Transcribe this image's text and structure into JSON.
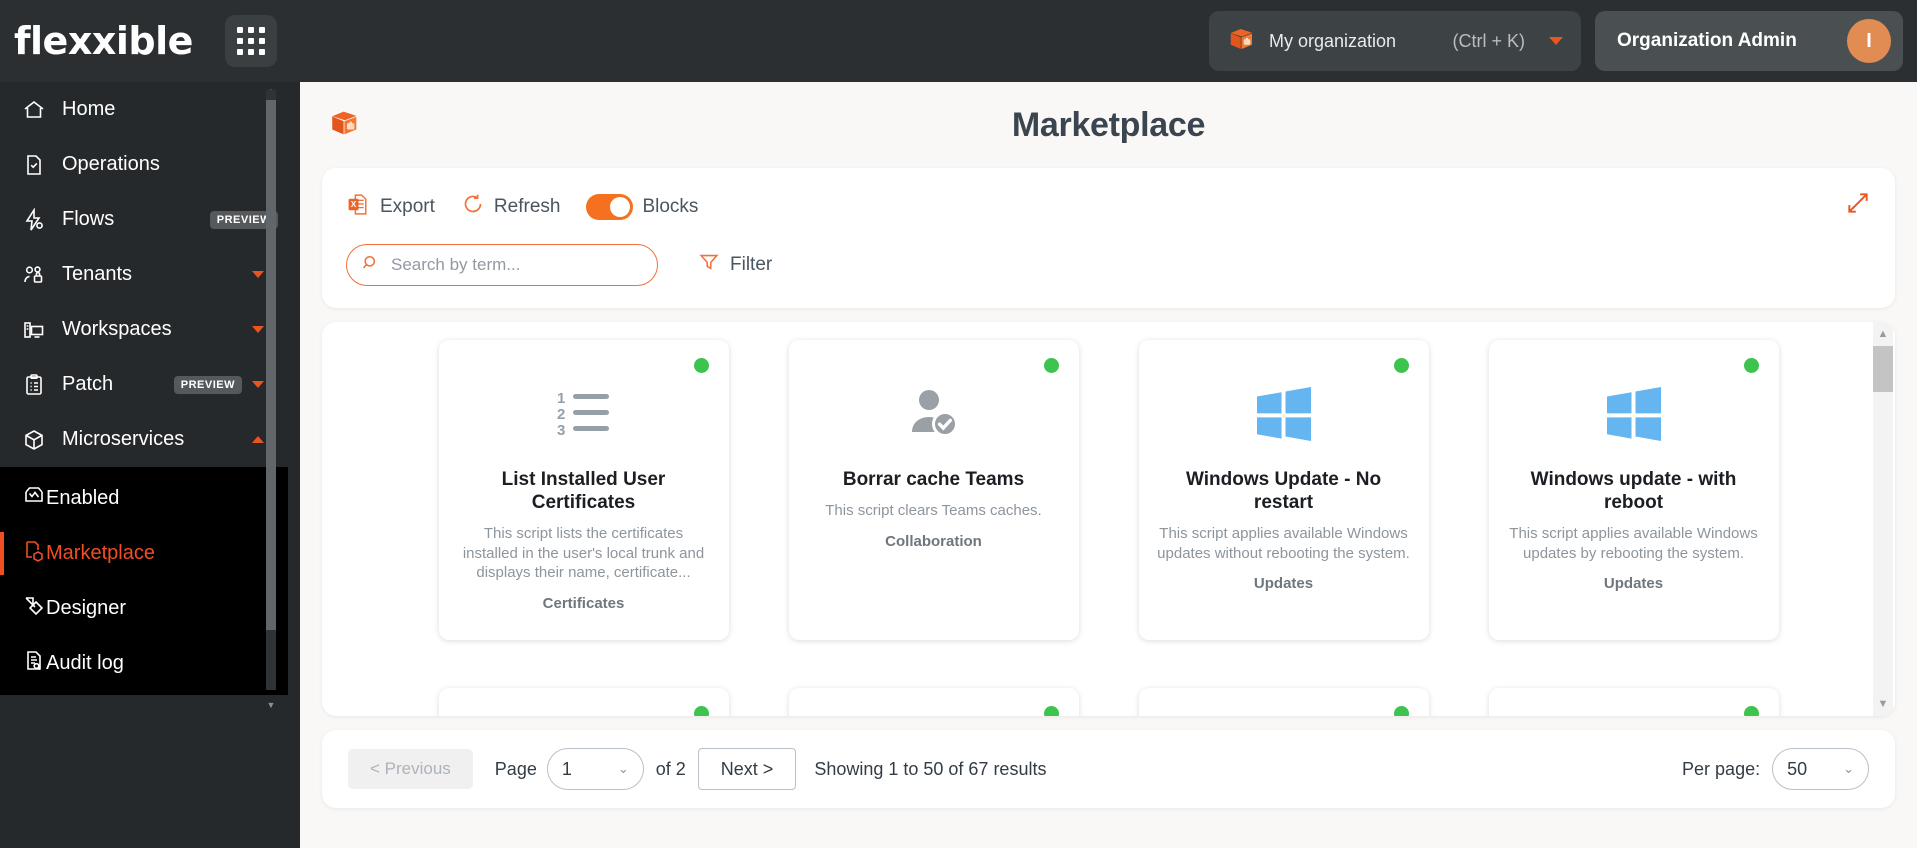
{
  "brand": {
    "logo_text": "flexxible",
    "grid_icon": "app-grid-icon"
  },
  "topbar": {
    "org_icon": "package-box-icon",
    "org_name": "My organization",
    "shortcut": "(Ctrl + K)",
    "admin_label": "Organization Admin",
    "avatar_initial": "I"
  },
  "sidebar": {
    "items": [
      {
        "label": "Home",
        "icon": "home-icon",
        "badge": "",
        "chevron": ""
      },
      {
        "label": "Operations",
        "icon": "document-check-icon",
        "badge": "",
        "chevron": ""
      },
      {
        "label": "Flows",
        "icon": "flow-bolt-icon",
        "badge": "PREVIEW",
        "chevron": ""
      },
      {
        "label": "Tenants",
        "icon": "users-lock-icon",
        "badge": "",
        "chevron": "down"
      },
      {
        "label": "Workspaces",
        "icon": "workspace-monitor-icon",
        "badge": "",
        "chevron": "down"
      },
      {
        "label": "Patch",
        "icon": "clipboard-list-icon",
        "badge": "PREVIEW",
        "chevron": "down"
      },
      {
        "label": "Microservices",
        "icon": "cube-icon",
        "badge": "",
        "chevron": "up"
      }
    ],
    "submenu": [
      {
        "label": "Enabled",
        "icon": "inbox-chart-icon",
        "active": false
      },
      {
        "label": "Marketplace",
        "icon": "marketplace-icon",
        "active": true
      },
      {
        "label": "Designer",
        "icon": "designer-ruler-icon",
        "active": false
      },
      {
        "label": "Audit log",
        "icon": "audit-log-icon",
        "active": false
      }
    ]
  },
  "page": {
    "title": "Marketplace",
    "icon": "package-box-icon"
  },
  "toolbar": {
    "export_label": "Export",
    "export_icon": "excel-file-icon",
    "refresh_label": "Refresh",
    "refresh_icon": "refresh-circle-icon",
    "blocks_label": "Blocks",
    "blocks_toggle_on": true,
    "expand_icon": "expand-diagonal-icon"
  },
  "search": {
    "placeholder": "Search by term...",
    "value": "",
    "icon": "search-icon"
  },
  "filter": {
    "label": "Filter",
    "icon": "funnel-icon"
  },
  "cards": [
    {
      "title": "List Installed User Certificates",
      "description": "This script lists the certificates installed in the user's local trunk and displays their name, certificate...",
      "category": "Certificates",
      "icon": "numbered-list-icon",
      "status": "enabled"
    },
    {
      "title": "Borrar cache Teams",
      "description": "This script clears Teams caches.",
      "category": "Collaboration",
      "icon": "user-check-icon",
      "status": "enabled"
    },
    {
      "title": "Windows Update - No restart",
      "description": "This script applies available Windows updates without rebooting the system.",
      "category": "Updates",
      "icon": "windows-logo-icon",
      "status": "enabled"
    },
    {
      "title": "Windows update - with reboot",
      "description": "This script applies available Windows updates by rebooting the system.",
      "category": "Updates",
      "icon": "windows-logo-icon",
      "status": "enabled"
    }
  ],
  "cards_row2_count": 4,
  "pagination": {
    "previous_label": "< Previous",
    "page_label": "Page",
    "page_value": "1",
    "of_label": "of 2",
    "next_label": "Next >",
    "showing_text": "Showing 1 to 50 of 67 results",
    "per_page_label": "Per page:",
    "per_page_value": "50"
  },
  "colors": {
    "accent_orange": "#f0501f",
    "toggle_orange": "#f5701f",
    "status_green": "#3ec34f",
    "windows_blue": "#64b5f0",
    "sidebar_bg": "#26292b",
    "topbar_bg": "#2b2f31",
    "canvas_bg": "#faf8f6"
  }
}
